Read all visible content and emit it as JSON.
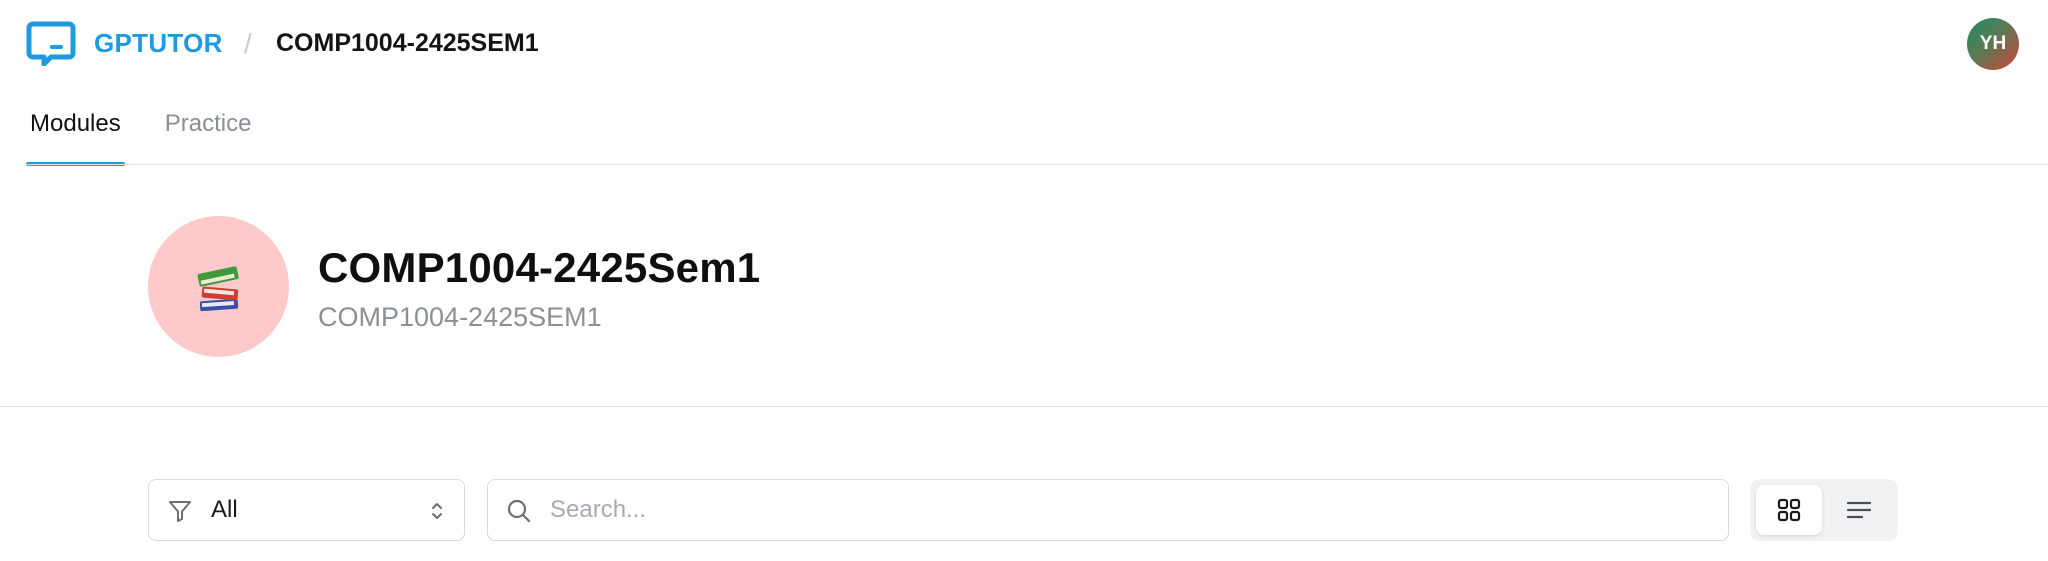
{
  "header": {
    "brand_name": "GPTUTOR",
    "breadcrumb_separator": "/",
    "breadcrumb_course": "COMP1004-2425SEM1",
    "avatar_initials": "YH"
  },
  "tabs": [
    {
      "label": "Modules",
      "active": true
    },
    {
      "label": "Practice",
      "active": false
    }
  ],
  "course": {
    "emoji": "📚",
    "title": "COMP1004-2425Sem1",
    "code": "COMP1004-2425SEM1"
  },
  "toolbar": {
    "filter_value": "All",
    "search_placeholder": "Search...",
    "search_value": "",
    "view_modes": [
      "grid",
      "list"
    ],
    "active_view": "grid"
  },
  "icons": {
    "brand": "chat-bubble-icon",
    "filter": "funnel-icon",
    "select_arrows": "chevron-up-down-icon",
    "search": "magnifier-icon",
    "grid_view": "grid-icon",
    "list_view": "list-icon"
  },
  "colors": {
    "accent": "#1e9ae0",
    "course_badge_bg": "#fdc9c9",
    "muted_text": "#8b9097",
    "border": "#d7dade"
  }
}
